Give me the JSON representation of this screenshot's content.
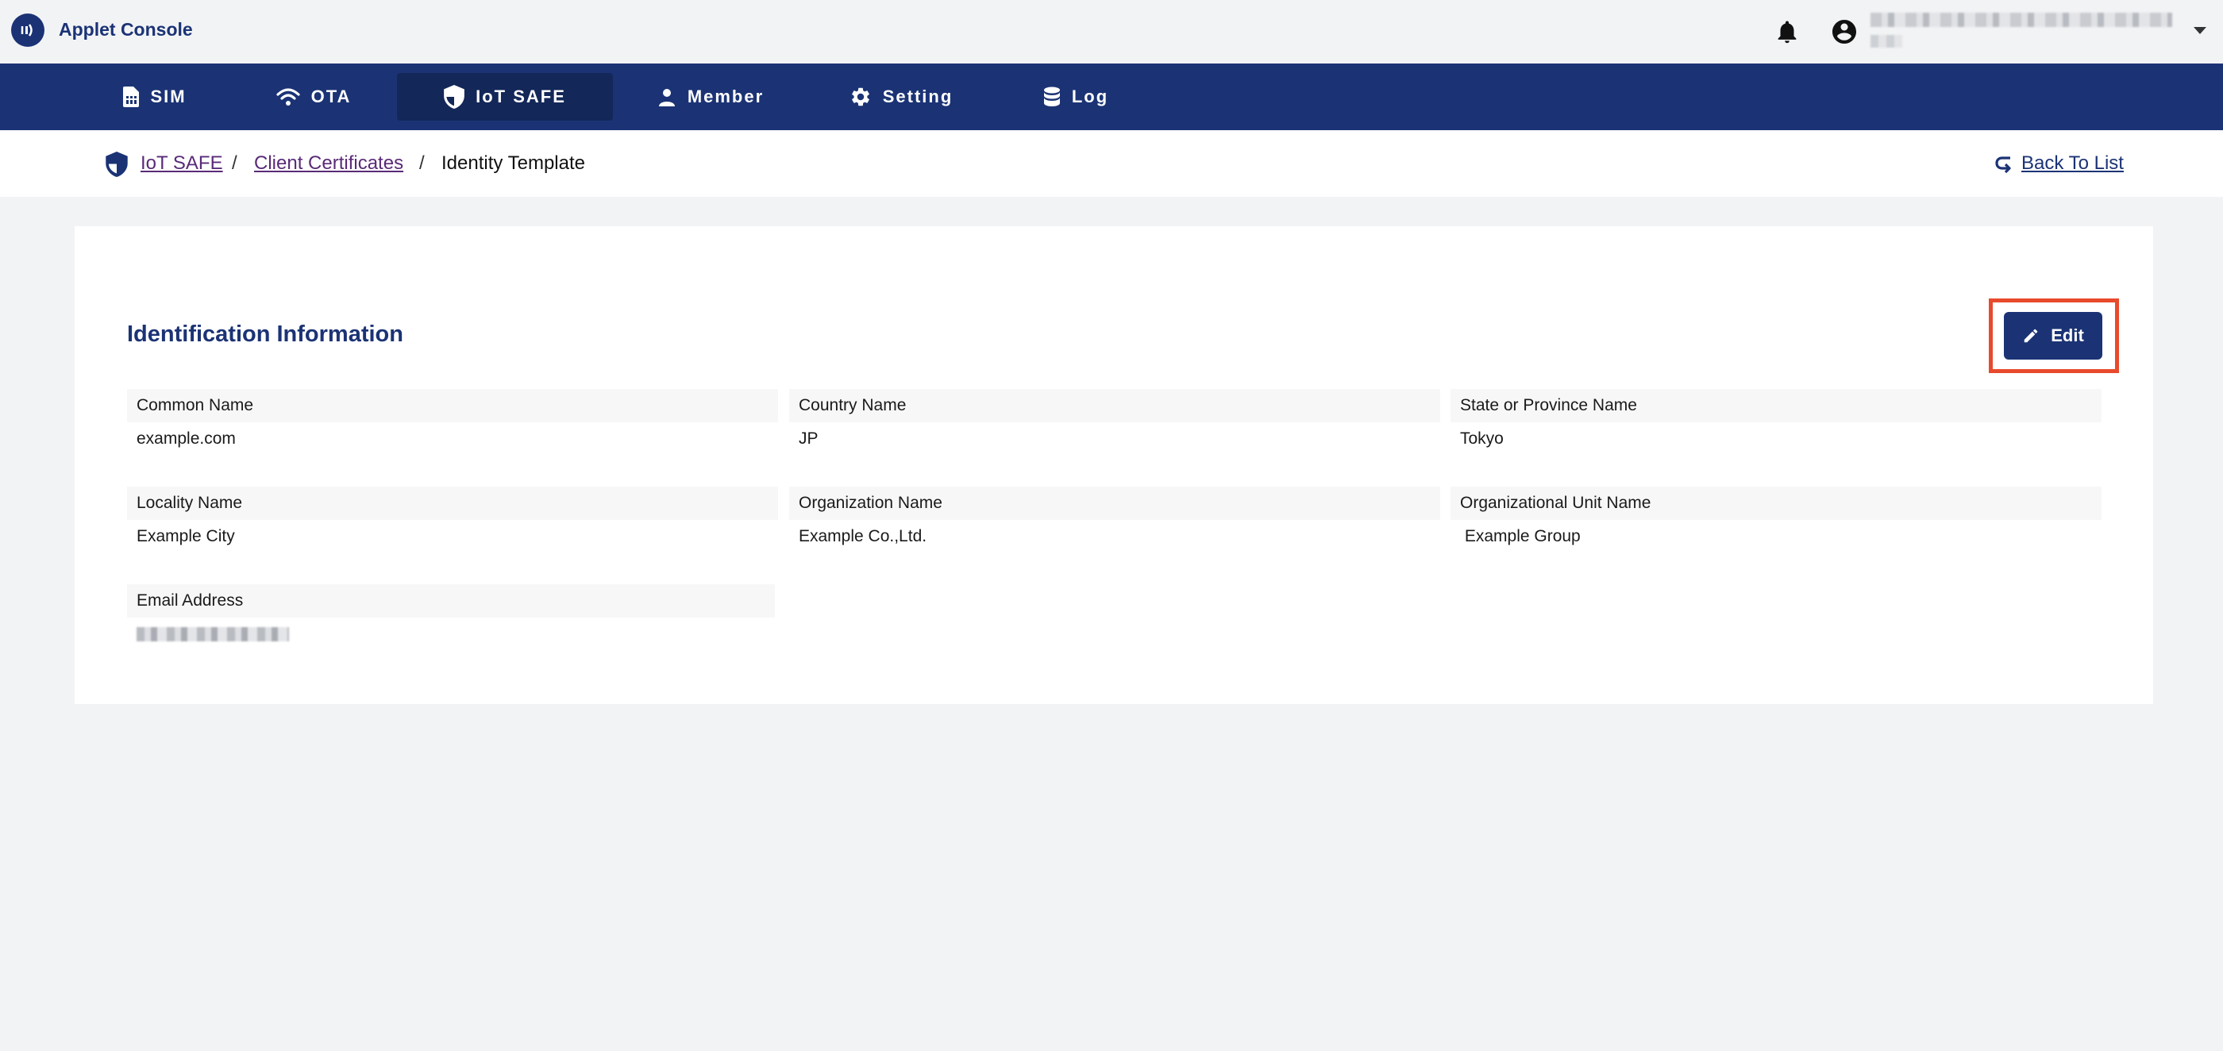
{
  "header": {
    "app_title": "Applet Console",
    "icons": [
      "notifications-bell-icon",
      "account-circle-icon",
      "dropdown-caret-icon"
    ]
  },
  "nav": {
    "items": [
      {
        "label": "SIM",
        "icon": "sim-card-icon"
      },
      {
        "label": "OTA",
        "icon": "wifi-icon"
      },
      {
        "label": "IoT SAFE",
        "icon": "shield-icon",
        "active": true
      },
      {
        "label": "Member",
        "icon": "person-icon"
      },
      {
        "label": "Setting",
        "icon": "gear-icon"
      },
      {
        "label": "Log",
        "icon": "database-icon"
      }
    ]
  },
  "breadcrumb": {
    "items": [
      "IoT SAFE",
      "Client Certificates",
      "Identity Template"
    ],
    "separator": "/",
    "back_label": "Back To List"
  },
  "card": {
    "title": "Identification Information",
    "edit_label": "Edit",
    "fields": [
      {
        "label": "Common Name",
        "value": "example.com"
      },
      {
        "label": "Country Name",
        "value": "JP"
      },
      {
        "label": "State or Province Name",
        "value": "Tokyo"
      },
      {
        "label": "Locality Name",
        "value": "Example City"
      },
      {
        "label": "Organization Name",
        "value": "Example Co.,Ltd."
      },
      {
        "label": "Organizational Unit Name",
        "value": " Example Group"
      },
      {
        "label": "Email Address",
        "value": null
      }
    ]
  },
  "colors": {
    "brand": "#1b3375",
    "nav_active": "#132758",
    "highlight": "#e84a2c",
    "page_bg": "#f2f3f5"
  }
}
